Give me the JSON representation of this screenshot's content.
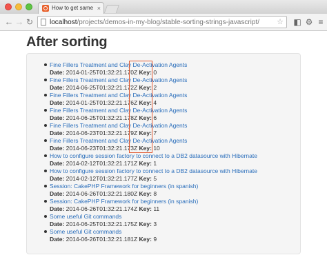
{
  "browser": {
    "tab_title": "How to get same results w",
    "tab_close": "×",
    "url_host": "localhost",
    "url_path": "/projects/demos-in-my-blog/stable-sorting-strings-javascript/",
    "icons": {
      "back": "arrow-left-icon",
      "forward": "arrow-right-icon",
      "reload": "reload-icon",
      "bookmark": "star-icon",
      "extension": "puzzle-icon",
      "settings": "gear-icon",
      "menu": "hamburger-menu-icon"
    }
  },
  "page": {
    "title": "After sorting",
    "date_label": "Date:",
    "key_label": "Key:",
    "entries": [
      {
        "title": "Fine Fillers Treatment and Clay De-Activation Agents",
        "date": "2014-01-25T01:32:21.170Z",
        "key": "0"
      },
      {
        "title": "Fine Fillers Treatment and Clay De-Activation Agents",
        "date": "2014-06-25T01:32:21.172Z",
        "key": "2"
      },
      {
        "title": "Fine Fillers Treatment and Clay De-Activation Agents",
        "date": "2014-01-25T01:32:21.176Z",
        "key": "4"
      },
      {
        "title": "Fine Fillers Treatment and Clay De-Activation Agents",
        "date": "2014-06-25T01:32:21.178Z",
        "key": "6"
      },
      {
        "title": "Fine Fillers Treatment and Clay De-Activation Agents",
        "date": "2014-06-23T01:32:21.179Z",
        "key": "7"
      },
      {
        "title": "Fine Fillers Treatment and Clay De-Activation Agents",
        "date": "2014-06-23T01:32:21.173Z",
        "key": "10"
      },
      {
        "title": "How to configure session factory to connect to a DB2 datasource with Hibernate",
        "date": "2014-02-12T01:32:21.171Z",
        "key": "1"
      },
      {
        "title": "How to configure session factory to connect to a DB2 datasource with Hibernate",
        "date": "2014-02-12T01:32:21.177Z",
        "key": "5"
      },
      {
        "title": "Session: CakePHP Framework for beginners (in spanish)",
        "date": "2014-06-26T01:32:21.180Z",
        "key": "8"
      },
      {
        "title": "Session: CakePHP Framework for beginners (in spanish)",
        "date": "2014-06-26T01:32:21.174Z",
        "key": "11"
      },
      {
        "title": "Some useful Git commands",
        "date": "2014-06-25T01:32:21.175Z",
        "key": "3"
      },
      {
        "title": "Some useful Git commands",
        "date": "2014-06-26T01:32:21.181Z",
        "key": "9"
      }
    ]
  },
  "colors": {
    "link": "#2a6ebb",
    "highlight_box": "#e0582f",
    "panel_bg": "#f5f5f5"
  }
}
